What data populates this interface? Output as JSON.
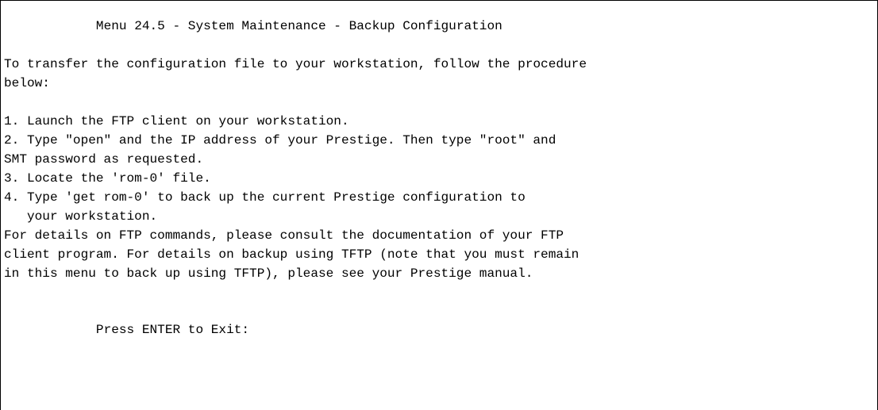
{
  "screen": {
    "title": "Menu 24.5 - System Maintenance - Backup Configuration",
    "intro": [
      "To transfer the configuration file to your workstation, follow the procedure",
      "below:"
    ],
    "steps": [
      "1. Launch the FTP client on your workstation.",
      "2. Type \"open\" and the IP address of your Prestige. Then type \"root\" and",
      "SMT password as requested.",
      "3. Locate the 'rom-0' file.",
      "4. Type 'get rom-0' to back up the current Prestige configuration to",
      "   your workstation."
    ],
    "details": [
      "For details on FTP commands, please consult the documentation of your FTP",
      "client program. For details on backup using TFTP (note that you must remain",
      "in this menu to back up using TFTP), please see your Prestige manual."
    ],
    "prompt": "Press ENTER to Exit:"
  }
}
